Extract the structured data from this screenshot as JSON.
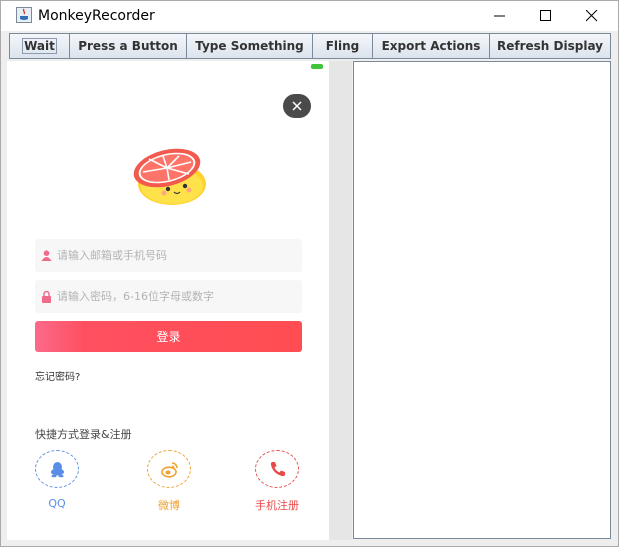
{
  "window": {
    "title": "MonkeyRecorder"
  },
  "toolbar": {
    "wait_label": "Wait",
    "press_label": "Press a Button",
    "type_label": "Type Something",
    "fling_label": "Fling",
    "export_label": "Export Actions",
    "refresh_label": "Refresh Display"
  },
  "phone": {
    "email_placeholder": "请输入邮箱或手机号码",
    "password_placeholder": "请输入密码，6-16位字母或数字",
    "login_label": "登录",
    "forgot_label": "忘记密码?",
    "quick_title": "快捷方式登录&注册",
    "social": [
      {
        "label": "QQ",
        "color": "#5a8ee6",
        "icon": "penguin-icon"
      },
      {
        "label": "微博",
        "color": "#f0a030",
        "icon": "weibo-icon"
      },
      {
        "label": "手机注册",
        "color": "#e84a4a",
        "icon": "phone-icon"
      }
    ]
  },
  "colors": {
    "accent": "#ff4d52",
    "status_green": "#41c33b"
  }
}
